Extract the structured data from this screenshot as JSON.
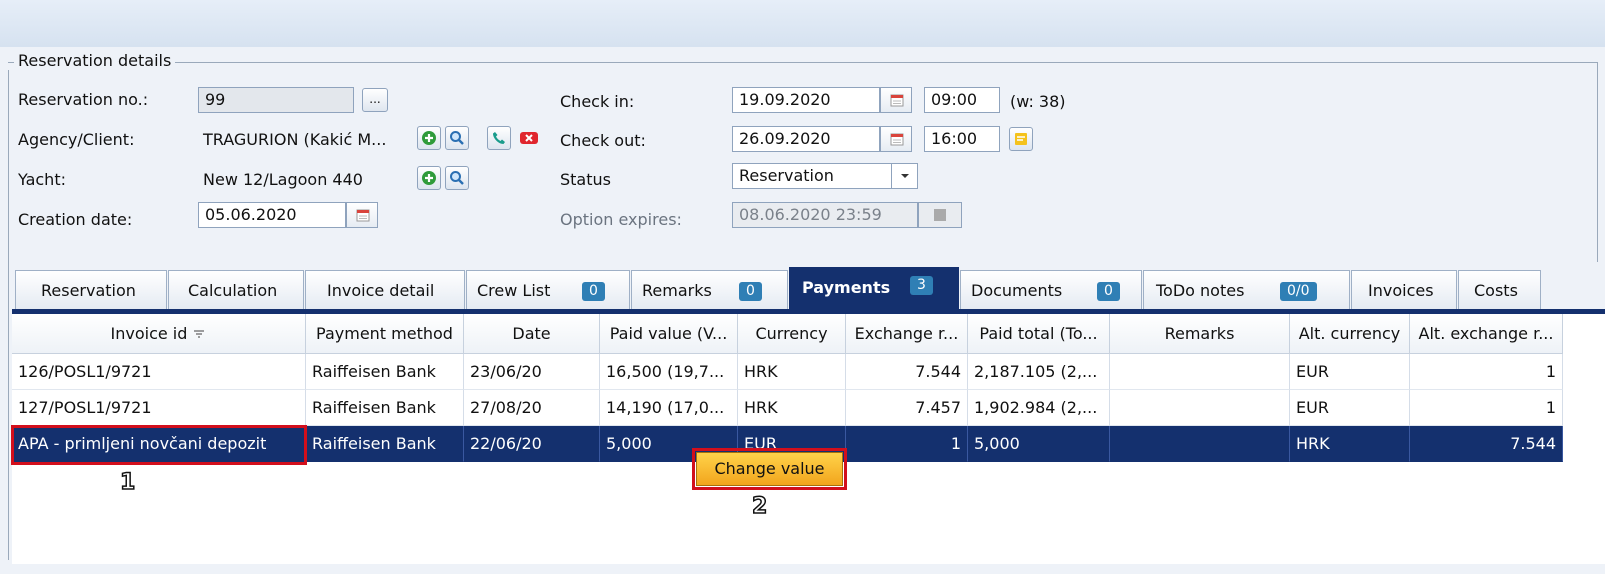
{
  "details": {
    "legend": "Reservation details",
    "reservation_no_label": "Reservation no.:",
    "reservation_no": "99",
    "more_btn": "...",
    "agency_label": "Agency/Client:",
    "agency_value": "TRAGURION (Kakić M...",
    "yacht_label": "Yacht:",
    "yacht_value": "New 12/Lagoon 440",
    "creation_label": "Creation date:",
    "creation_value": "05.06.2020",
    "checkin_label": "Check in:",
    "checkin_date": "19.09.2020",
    "checkin_time": "09:00",
    "week": "(w: 38)",
    "checkout_label": "Check out:",
    "checkout_date": "26.09.2020",
    "checkout_time": "16:00",
    "status_label": "Status",
    "status_value": "Reservation",
    "option_label": "Option expires:",
    "option_value": "08.06.2020 23:59"
  },
  "tabs": [
    {
      "label": "Reservation"
    },
    {
      "label": "Calculation"
    },
    {
      "label": "Invoice detail"
    },
    {
      "label": "Crew List",
      "badge": "0"
    },
    {
      "label": "Remarks",
      "badge": "0"
    },
    {
      "label": "Payments",
      "badge": "3",
      "active": true
    },
    {
      "label": "Documents",
      "badge": "0"
    },
    {
      "label": "ToDo notes",
      "badge": "0/0"
    },
    {
      "label": "Invoices"
    },
    {
      "label": "Costs"
    }
  ],
  "grid": {
    "columns": [
      "Invoice id",
      "Payment method",
      "Date",
      "Paid value (V...",
      "Currency",
      "Exchange r...",
      "Paid total (To...",
      "Remarks",
      "Alt. currency",
      "Alt. exchange r..."
    ],
    "rows": [
      [
        "126/POSL1/9721",
        "Raiffeisen Bank",
        "23/06/20",
        "16,500 (19,7...",
        "HRK",
        "7.544",
        "2,187.105 (2,...",
        "",
        "EUR",
        "1"
      ],
      [
        "127/POSL1/9721",
        "Raiffeisen Bank",
        "27/08/20",
        "14,190 (17,0...",
        "HRK",
        "7.457",
        "1,902.984 (2,...",
        "",
        "EUR",
        "1"
      ],
      [
        "APA - primljeni novčani depozit",
        "Raiffeisen Bank",
        "22/06/20",
        "5,000",
        "EUR",
        "1",
        "5,000",
        "",
        "HRK",
        "7.544"
      ]
    ]
  },
  "context_button": "Change value",
  "callouts": [
    "1",
    "2"
  ]
}
